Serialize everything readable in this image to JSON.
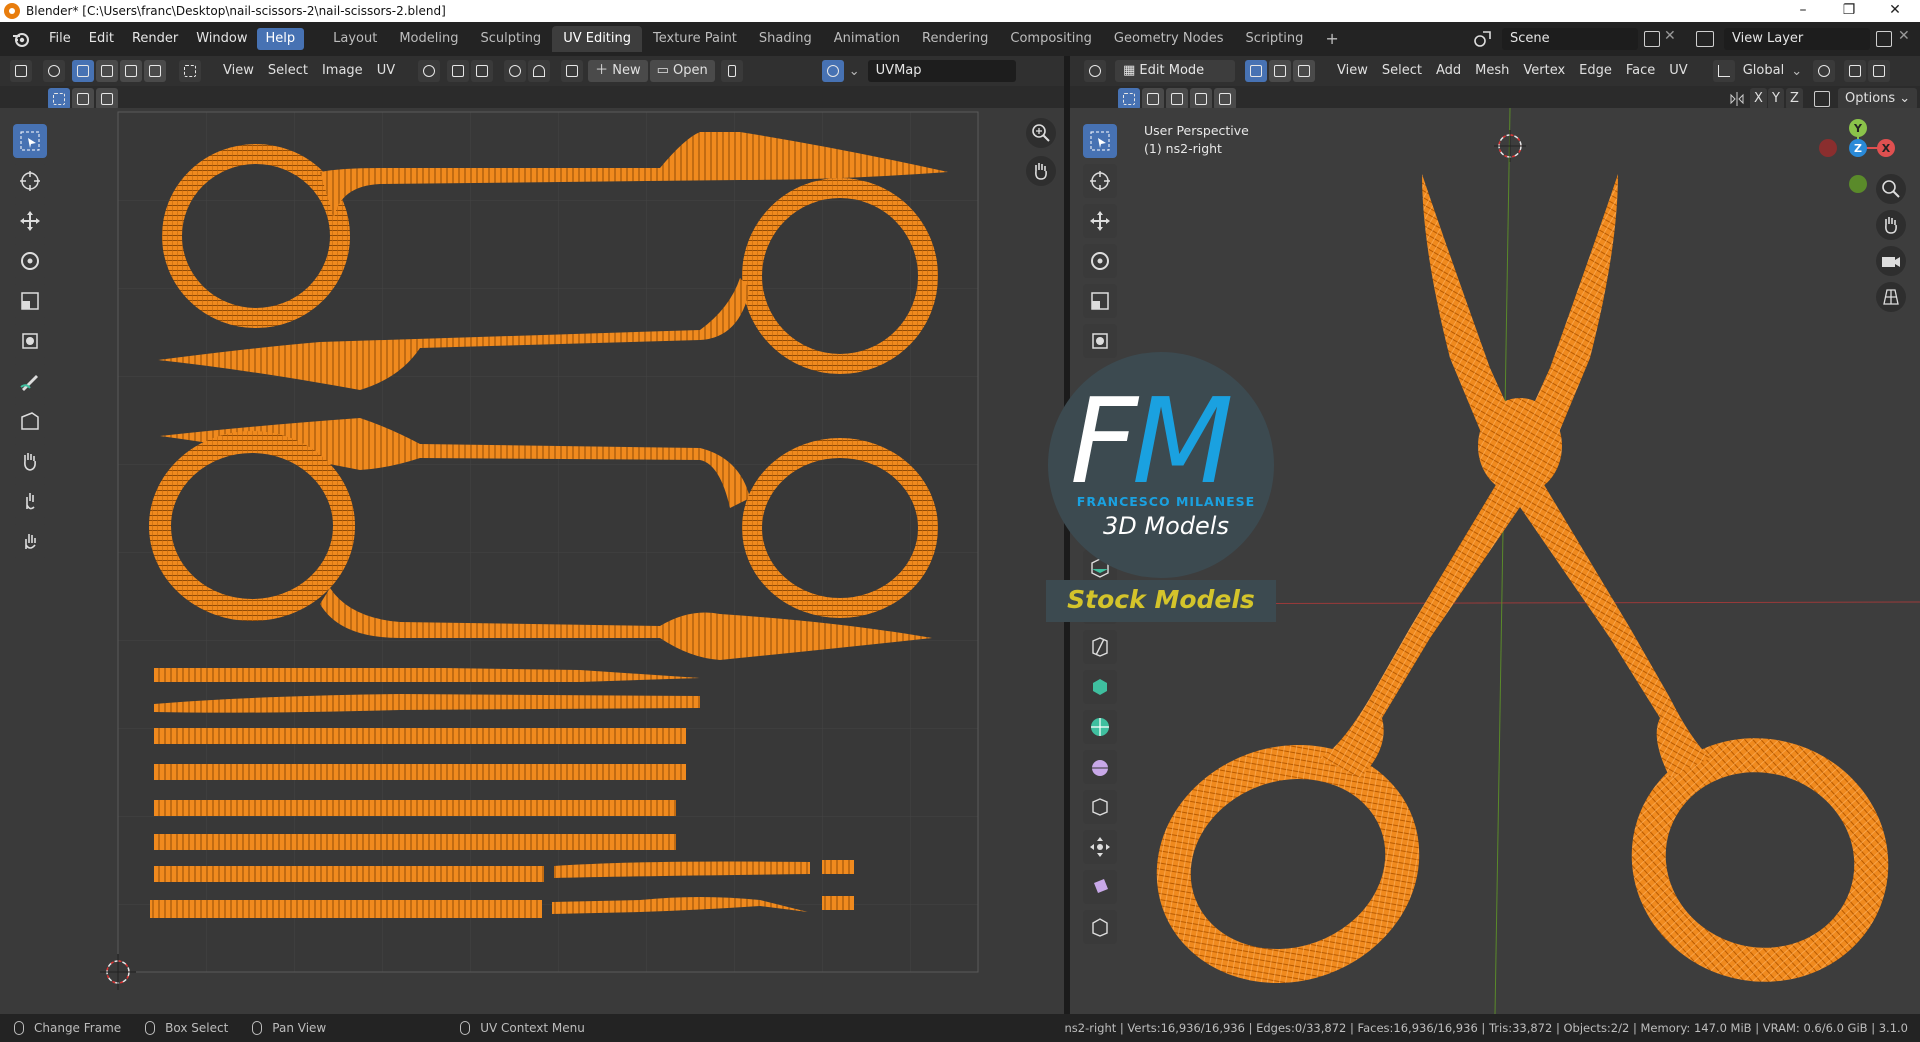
{
  "window": {
    "title": "Blender* [C:\\Users\\franc\\Desktop\\nail-scissors-2\\nail-scissors-2.blend]",
    "controls": [
      "–",
      "❐",
      "✕"
    ]
  },
  "menubar": {
    "menus": [
      "File",
      "Edit",
      "Render",
      "Window",
      "Help"
    ],
    "active_menu": "Help",
    "workspaces": [
      "Layout",
      "Modeling",
      "Sculpting",
      "UV Editing",
      "Texture Paint",
      "Shading",
      "Animation",
      "Rendering",
      "Compositing",
      "Geometry Nodes",
      "Scripting"
    ],
    "active_workspace": "UV Editing",
    "add_workspace": "+",
    "scene": "Scene",
    "view_layer": "View Layer"
  },
  "uv_editor": {
    "header": {
      "menus": [
        "View",
        "Select",
        "Image",
        "UV"
      ],
      "new_label": "New",
      "open_label": "Open",
      "uvmap": "UVMap"
    }
  },
  "viewport": {
    "header": {
      "mode": "Edit Mode",
      "menus": [
        "View",
        "Select",
        "Add",
        "Mesh",
        "Vertex",
        "Edge",
        "Face",
        "UV"
      ],
      "orientation": "Global",
      "options": "Options",
      "axes": [
        "X",
        "Y",
        "Z"
      ]
    },
    "info": {
      "perspective": "User Perspective",
      "object": "(1) ns2-right"
    },
    "gizmo": {
      "y": "Y",
      "z": "Z",
      "x": "X"
    }
  },
  "logo": {
    "letter_f": "F",
    "letter_m": "M",
    "name": "FRANCESCO MILANESE",
    "tagline": "3D Models",
    "banner": "Stock Models"
  },
  "statusbar": {
    "change_frame": "Change Frame",
    "box_select": "Box Select",
    "pan_view": "Pan View",
    "uv_context_menu": "UV Context Menu",
    "stats": "ns2-right | Verts:16,936/16,936 | Edges:0/33,872 | Faces:16,936/16,936 | Tris:33,872 | Objects:2/2 | Memory: 147.0 MiB | VRAM: 0.6/6.0 GiB | 3.1.0"
  },
  "colors": {
    "accent": "#4772b3",
    "uv_mesh": "#f08a1e",
    "logo_blue": "#1aa1e0",
    "logo_yellow": "#d4c42b"
  }
}
